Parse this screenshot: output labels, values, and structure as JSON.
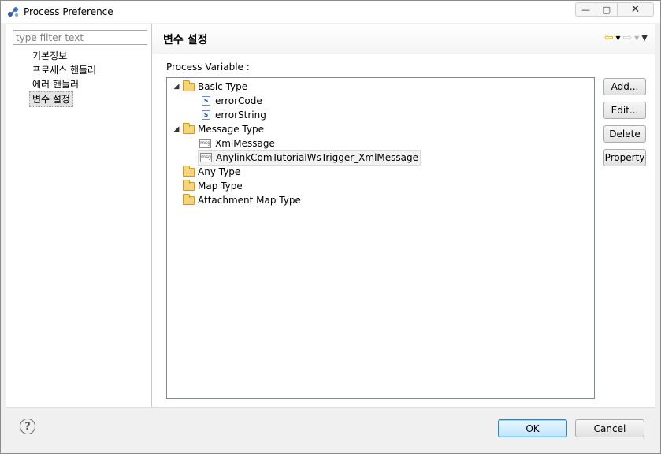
{
  "window": {
    "title": "Process Preference"
  },
  "window_buttons": {
    "minimize": "—",
    "maximize": "▢",
    "close": "✕"
  },
  "sidebar": {
    "filter_placeholder": "type filter text",
    "items": [
      {
        "label": "기본정보"
      },
      {
        "label": "프로세스 핸들러"
      },
      {
        "label": "에러 핸들러"
      },
      {
        "label": "변수 설정",
        "selected": true
      }
    ]
  },
  "header": {
    "title": "변수 설정",
    "nav": {
      "back": "⇦",
      "back_menu": "▾",
      "forward": "⇨",
      "forward_menu": "▾",
      "view_menu": "▼"
    }
  },
  "main": {
    "section_label": "Process Variable :",
    "tree": [
      {
        "type": "folder",
        "label": "Basic Type",
        "expanded": true,
        "twisty": "◢"
      },
      {
        "type": "s",
        "icon_text": "s",
        "label": "errorCode"
      },
      {
        "type": "s",
        "icon_text": "s",
        "label": "errorString"
      },
      {
        "type": "folder",
        "label": "Message Type",
        "expanded": true,
        "twisty": "◢"
      },
      {
        "type": "msg",
        "icon_text": "msg",
        "label": "XmlMessage"
      },
      {
        "type": "msg",
        "icon_text": "msg",
        "label": "AnylinkComTutorialWsTrigger_XmlMessage",
        "selected": true
      },
      {
        "type": "folder",
        "label": "Any Type"
      },
      {
        "type": "folder",
        "label": "Map Type"
      },
      {
        "type": "folder",
        "label": "Attachment Map Type"
      }
    ],
    "buttons": {
      "add": "Add...",
      "edit": "Edit...",
      "delete": "Delete",
      "property": "Property"
    }
  },
  "footer": {
    "help": "?",
    "ok": "OK",
    "cancel": "Cancel"
  }
}
